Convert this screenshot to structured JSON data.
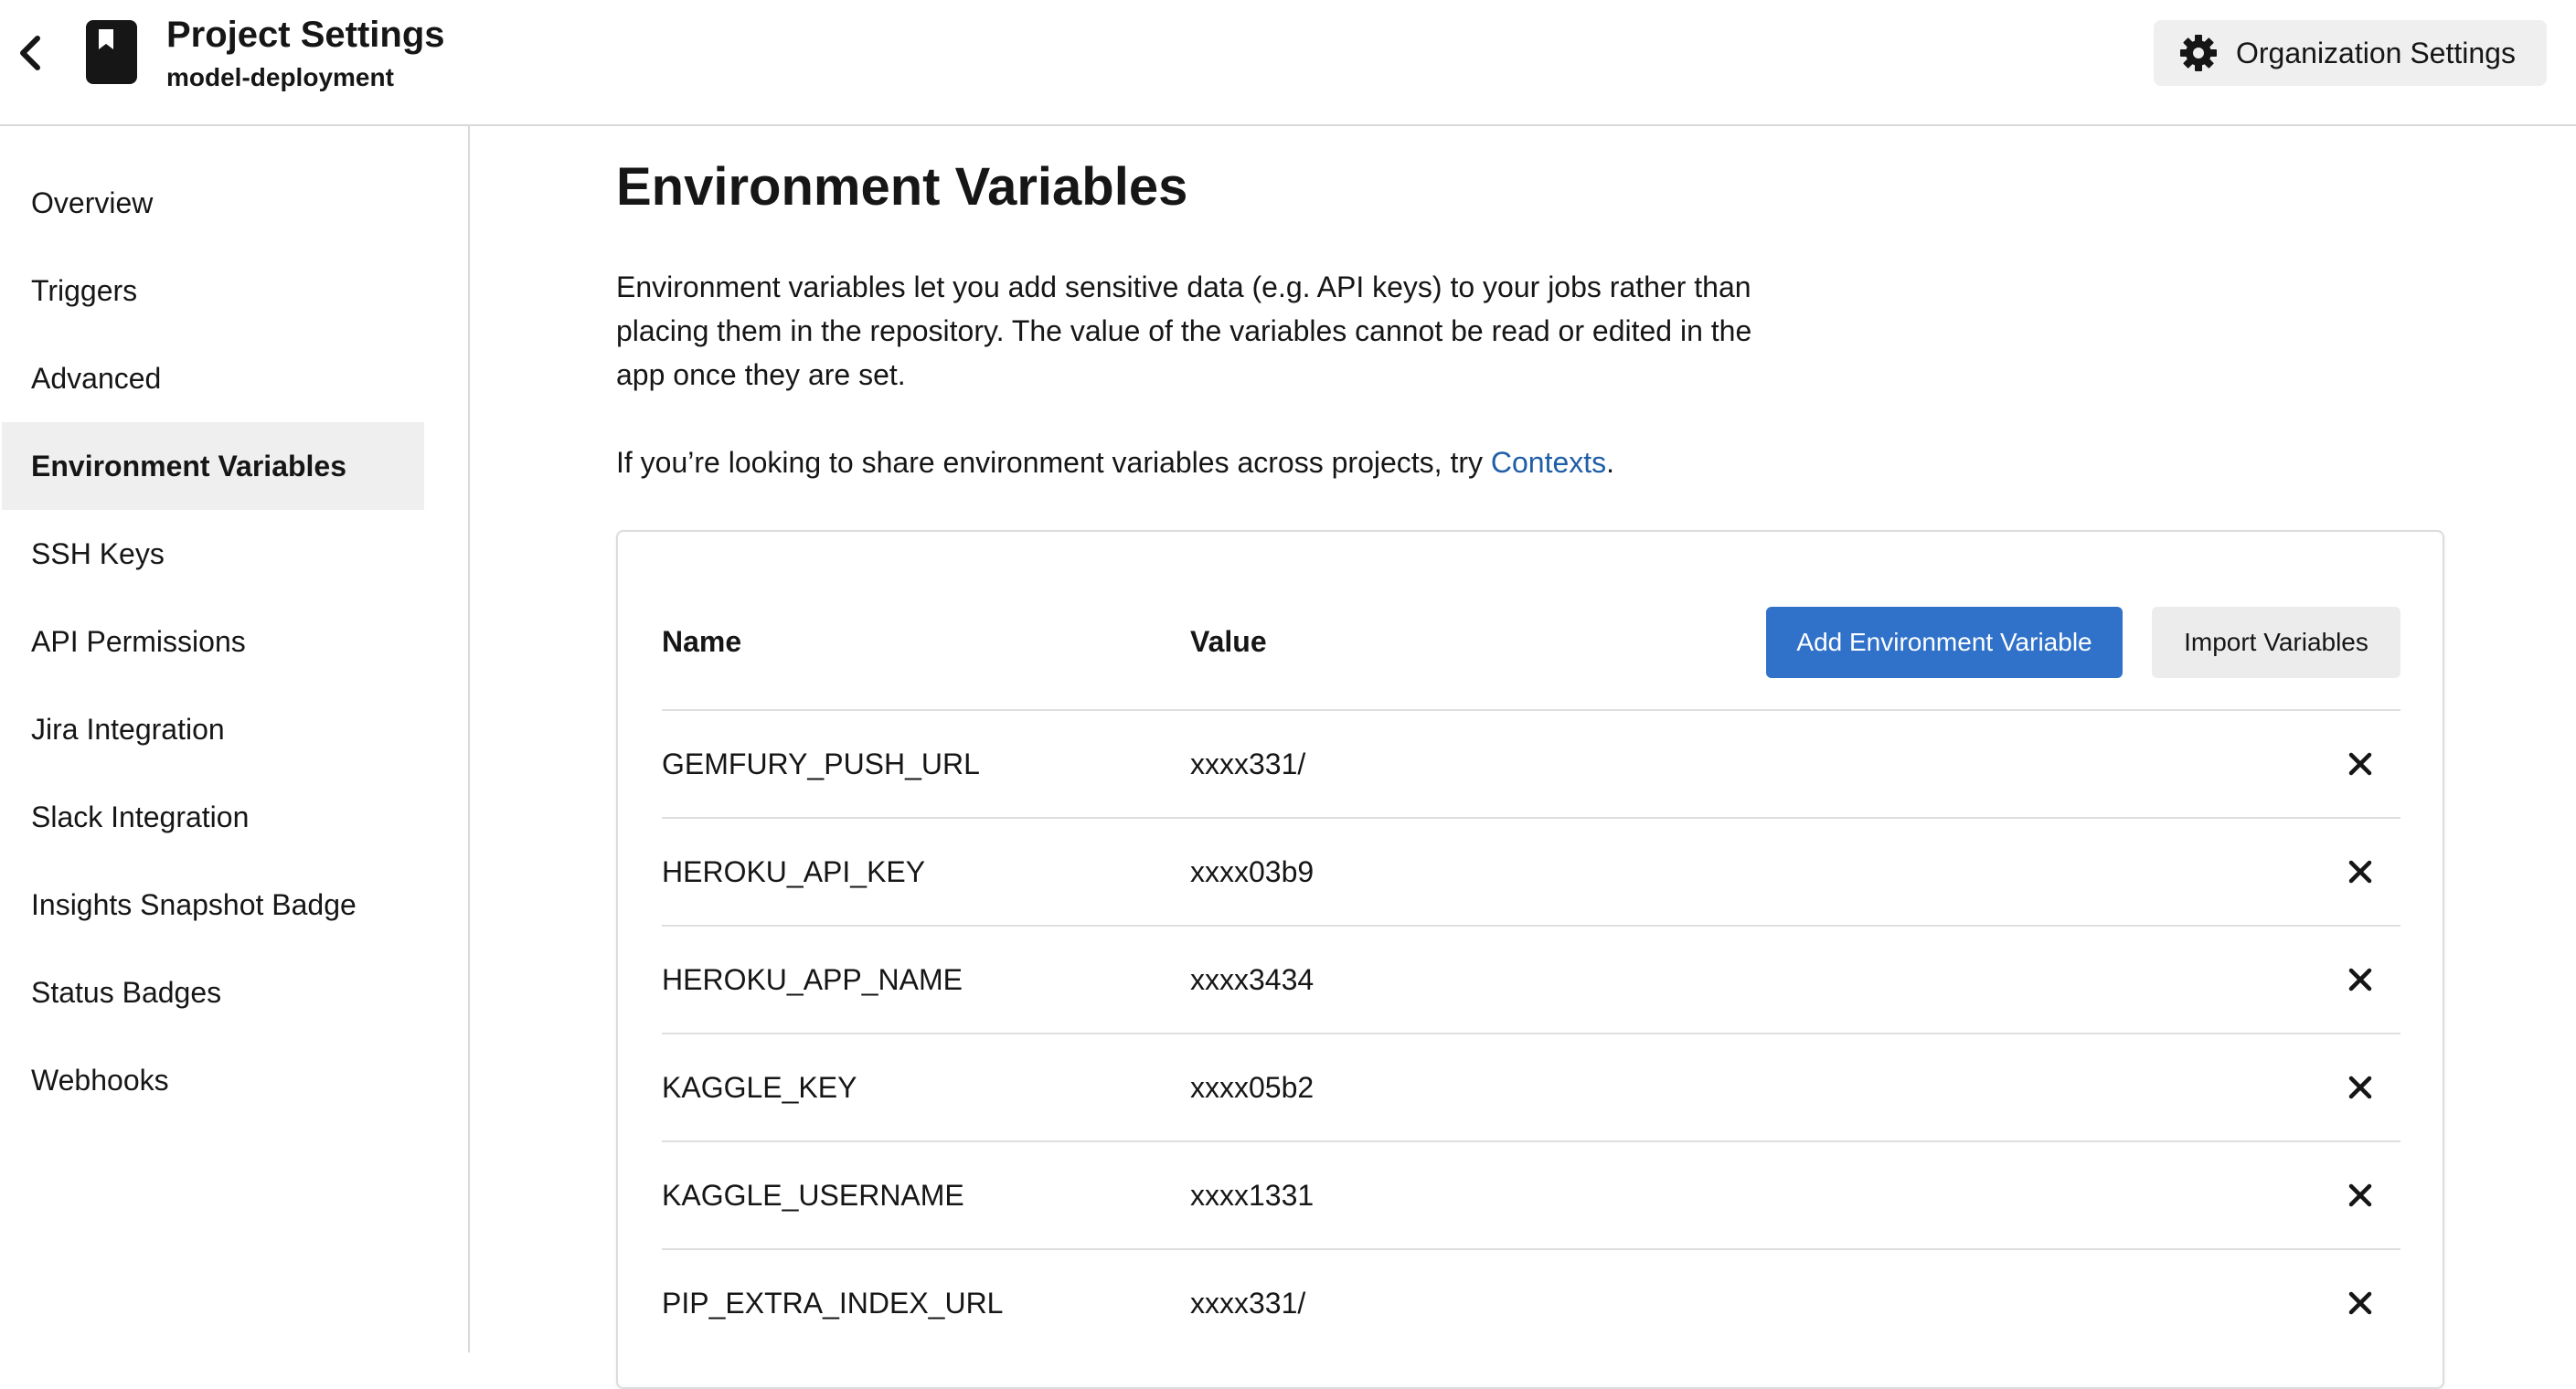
{
  "header": {
    "back_icon": "chevron-left-icon",
    "project_icon": "bookmark-icon",
    "title": "Project Settings",
    "subtitle": "model-deployment",
    "org_settings_icon": "gear-icon",
    "org_settings_label": "Organization Settings"
  },
  "sidebar": {
    "items": [
      {
        "label": "Overview",
        "active": false
      },
      {
        "label": "Triggers",
        "active": false
      },
      {
        "label": "Advanced",
        "active": false
      },
      {
        "label": "Environment Variables",
        "active": true
      },
      {
        "label": "SSH Keys",
        "active": false
      },
      {
        "label": "API Permissions",
        "active": false
      },
      {
        "label": "Jira Integration",
        "active": false
      },
      {
        "label": "Slack Integration",
        "active": false
      },
      {
        "label": "Insights Snapshot Badge",
        "active": false
      },
      {
        "label": "Status Badges",
        "active": false
      },
      {
        "label": "Webhooks",
        "active": false
      }
    ]
  },
  "main": {
    "title": "Environment Variables",
    "description": "Environment variables let you add sensitive data (e.g. API keys) to your jobs rather than placing them in the repository. The value of the variables cannot be read or edited in the app once they are set.",
    "share_prefix": "If you’re looking to share environment variables across projects, try ",
    "share_link": "Contexts",
    "share_suffix": "."
  },
  "table": {
    "columns": {
      "name": "Name",
      "value": "Value"
    },
    "add_button": "Add Environment Variable",
    "import_button": "Import Variables",
    "delete_icon": "close-icon",
    "rows": [
      {
        "name": "GEMFURY_PUSH_URL",
        "value": "xxxx331/"
      },
      {
        "name": "HEROKU_API_KEY",
        "value": "xxxx03b9"
      },
      {
        "name": "HEROKU_APP_NAME",
        "value": "xxxx3434"
      },
      {
        "name": "KAGGLE_KEY",
        "value": "xxxx05b2"
      },
      {
        "name": "KAGGLE_USERNAME",
        "value": "xxxx1331"
      },
      {
        "name": "PIP_EXTRA_INDEX_URL",
        "value": "xxxx331/"
      }
    ]
  },
  "colors": {
    "accent": "#3072c9",
    "link": "#1f5ea8",
    "active_bg": "#efefef",
    "border": "#d9d9d9"
  }
}
